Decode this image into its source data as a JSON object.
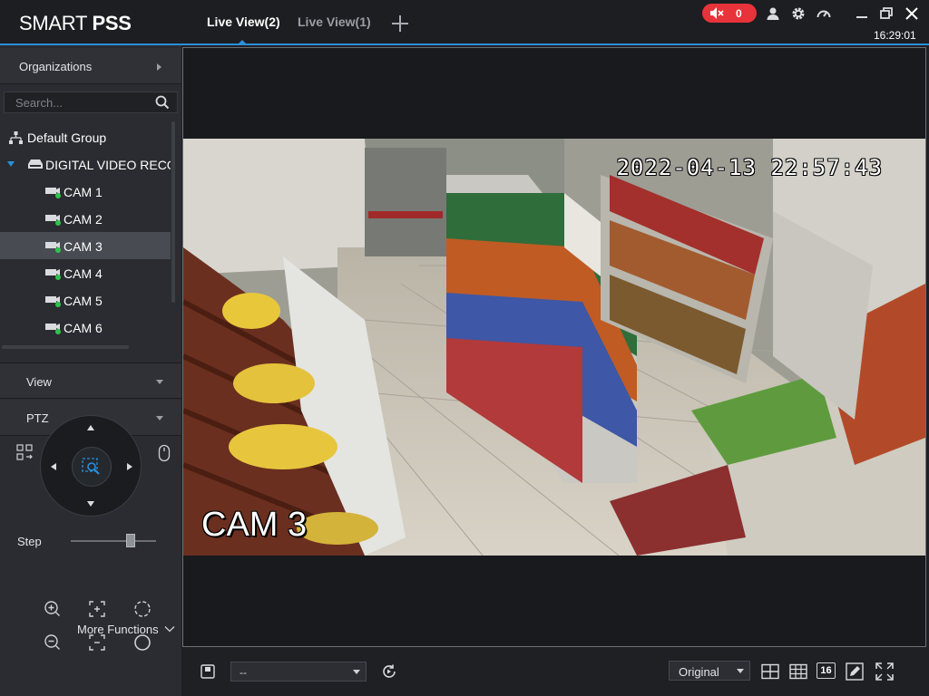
{
  "app": {
    "brand_light": "SMART",
    "brand_bold": "PSS",
    "accent_color": "#2b8fd9",
    "alarm_color": "#e8333a"
  },
  "tabs": [
    {
      "label": "Live View(2)",
      "active": true
    },
    {
      "label": "Live View(1)",
      "active": false
    }
  ],
  "titlebar": {
    "alarm_count": "0",
    "clock": "16:29:01",
    "icons": [
      "speaker-muted-icon",
      "user-icon",
      "gear-icon",
      "speedometer-icon",
      "minimize-icon",
      "restore-icon",
      "close-icon"
    ]
  },
  "sidebar": {
    "organizations_label": "Organizations",
    "search_placeholder": "Search...",
    "tree": {
      "group": "Default Group",
      "device": "DIGITAL VIDEO RECORDER",
      "cameras": [
        "CAM 1",
        "CAM 2",
        "CAM 3",
        "CAM 4",
        "CAM 5",
        "CAM 6"
      ],
      "selected_camera": "CAM 3"
    },
    "view_label": "View",
    "ptz_label": "PTZ",
    "step_label": "Step",
    "step_value": 0.7,
    "more_functions_label": "More Functions"
  },
  "video": {
    "timestamp": "2022-04-13 22:57:43",
    "camera_label": "CAM 3"
  },
  "bottombar": {
    "stream_value": "--",
    "ratio_value": "Original",
    "layout_label": "16"
  }
}
